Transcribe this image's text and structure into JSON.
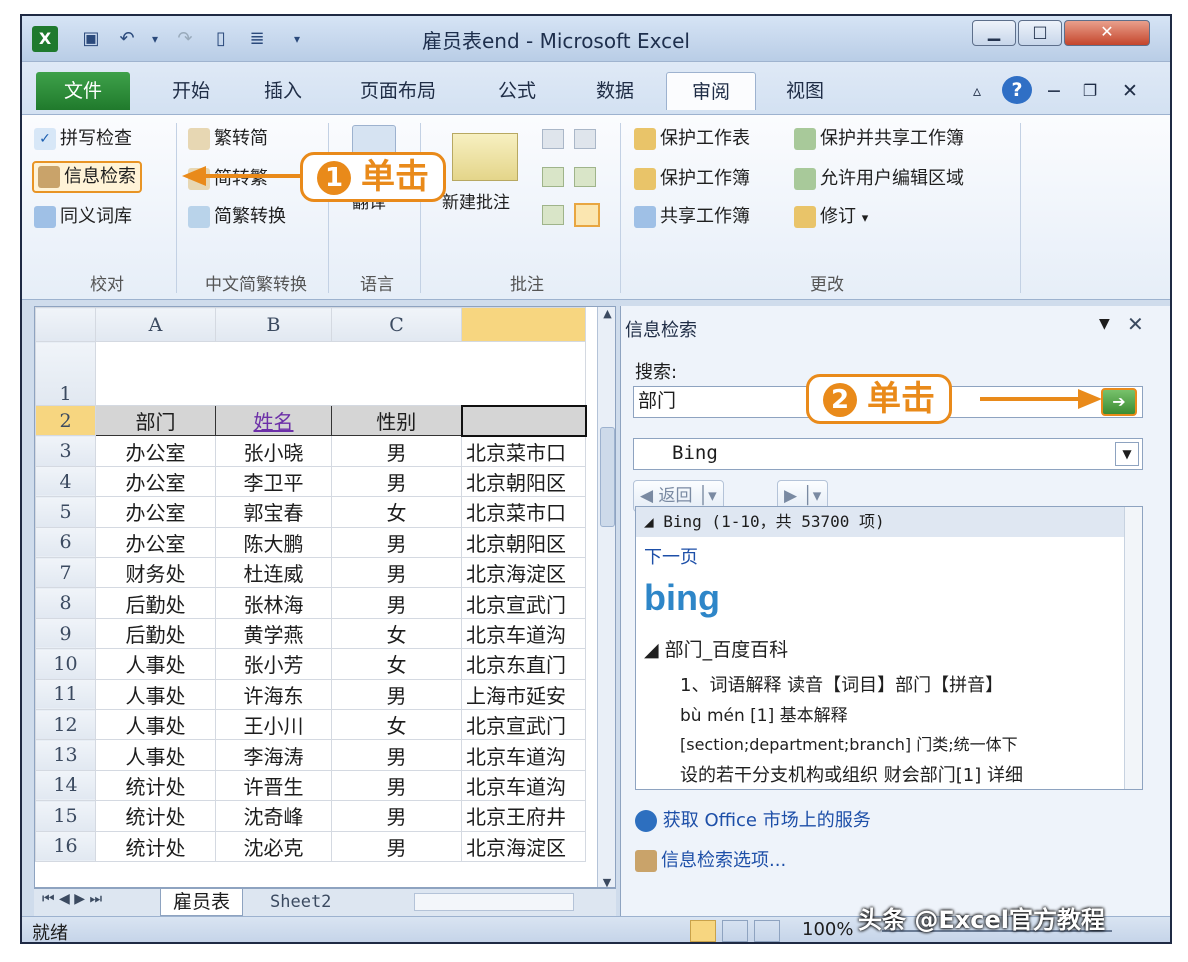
{
  "window": {
    "title": "雇员表end - Microsoft Excel"
  },
  "tabs": [
    {
      "label": "文件"
    },
    {
      "label": "开始"
    },
    {
      "label": "插入"
    },
    {
      "label": "页面布局"
    },
    {
      "label": "公式"
    },
    {
      "label": "数据"
    },
    {
      "label": "审阅"
    },
    {
      "label": "视图"
    }
  ],
  "ribbon": {
    "spell_check": "拼写检查",
    "info_search": "信息检索",
    "thesaurus": "同义词库",
    "to_simplified": "繁转简",
    "to_traditional": "简转繁",
    "convert": "简繁转换",
    "translate": "翻译",
    "new_comment": "新建批注",
    "protect_sheet": "保护工作表",
    "protect_workbook": "保护工作簿",
    "share_workbook": "共享工作簿",
    "protect_share": "保护并共享工作簿",
    "allow_edit_ranges": "允许用户编辑区域",
    "track_changes": "修订",
    "groups": {
      "proofing": "校对",
      "chinese": "中文简繁转换",
      "language": "语言",
      "comments": "批注",
      "changes": "更改"
    }
  },
  "callouts": {
    "c1_num": "1",
    "c1_text": "单击",
    "c2_num": "2",
    "c2_text": "单击"
  },
  "sheet": {
    "columns": [
      "A",
      "B",
      "C"
    ],
    "row1": "1",
    "header": {
      "row": "2",
      "dept": "部门",
      "name": "姓名",
      "gender": "性别"
    },
    "rows": [
      {
        "n": "3",
        "dept": "办公室",
        "name": "张小晓",
        "gender": "男",
        "addr": "北京菜市口"
      },
      {
        "n": "4",
        "dept": "办公室",
        "name": "李卫平",
        "gender": "男",
        "addr": "北京朝阳区"
      },
      {
        "n": "5",
        "dept": "办公室",
        "name": "郭宝春",
        "gender": "女",
        "addr": "北京菜市口"
      },
      {
        "n": "6",
        "dept": "办公室",
        "name": "陈大鹏",
        "gender": "男",
        "addr": "北京朝阳区"
      },
      {
        "n": "7",
        "dept": "财务处",
        "name": "杜连威",
        "gender": "男",
        "addr": "北京海淀区"
      },
      {
        "n": "8",
        "dept": "后勤处",
        "name": "张林海",
        "gender": "男",
        "addr": "北京宣武门"
      },
      {
        "n": "9",
        "dept": "后勤处",
        "name": "黄学燕",
        "gender": "女",
        "addr": "北京车道沟"
      },
      {
        "n": "10",
        "dept": "人事处",
        "name": "张小芳",
        "gender": "女",
        "addr": "北京东直门"
      },
      {
        "n": "11",
        "dept": "人事处",
        "name": "许海东",
        "gender": "男",
        "addr": "上海市延安"
      },
      {
        "n": "12",
        "dept": "人事处",
        "name": "王小川",
        "gender": "女",
        "addr": "北京宣武门"
      },
      {
        "n": "13",
        "dept": "人事处",
        "name": "李海涛",
        "gender": "男",
        "addr": "北京车道沟"
      },
      {
        "n": "14",
        "dept": "统计处",
        "name": "许晋生",
        "gender": "男",
        "addr": "北京车道沟"
      },
      {
        "n": "15",
        "dept": "统计处",
        "name": "沈奇峰",
        "gender": "男",
        "addr": "北京王府井"
      },
      {
        "n": "16",
        "dept": "统计处",
        "name": "沈必克",
        "gender": "男",
        "addr": "北京海淀区"
      }
    ],
    "tabs": [
      "雇员表",
      "Sheet2"
    ]
  },
  "pane": {
    "title": "信息检索",
    "search_label": "搜索:",
    "search_value": "部门",
    "source": "Bing",
    "back": "返回",
    "results_header": "◢ Bing (1-10，共 53700 项)",
    "next_page": "下一页",
    "bing_logo": "bing",
    "result_title": "◢ 部门_百度百科",
    "lines": [
      "1、词语解释 读音【词目】部门【拼音】",
      "bù mén [1] 基本解释",
      "[section;department;branch] 门类;统一体下",
      "设的若干分支机构或组织 财会部门[1] 详细"
    ],
    "office_link": "获取 Office 市场上的服务",
    "options_link": "信息检索选项..."
  },
  "status": {
    "ready": "就绪",
    "zoom": "100%"
  },
  "watermark": "头条 @Excel官方教程"
}
